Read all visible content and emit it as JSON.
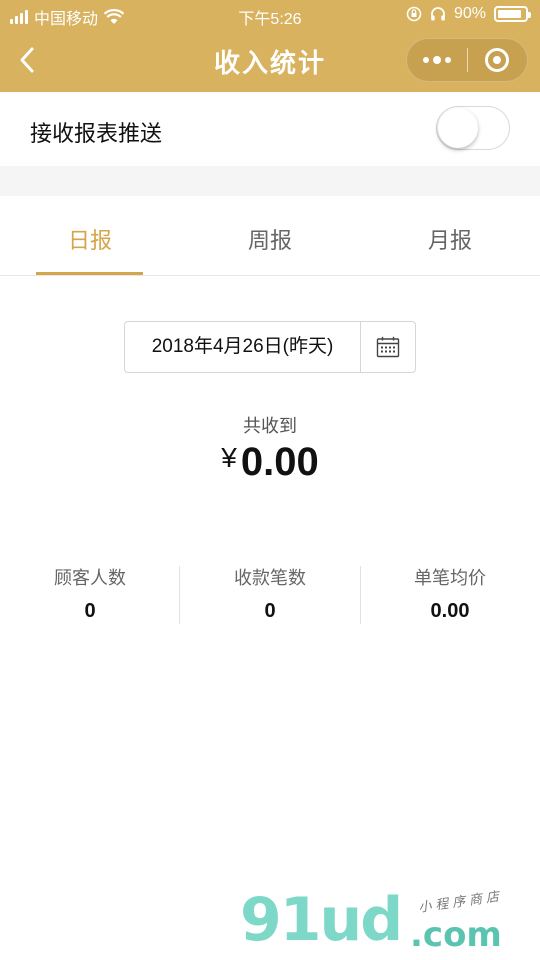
{
  "status_bar": {
    "carrier": "中国移动",
    "time": "下午5:26",
    "battery_text": "90%",
    "battery_level": 0.9
  },
  "nav": {
    "title": "收入统计",
    "back_icon": "chevron-left-icon",
    "more_icon": "more-dots-icon",
    "close_icon": "target-circle-icon"
  },
  "push": {
    "label": "接收报表推送",
    "enabled": false
  },
  "tabs": [
    {
      "label": "日报",
      "active": true
    },
    {
      "label": "周报",
      "active": false
    },
    {
      "label": "月报",
      "active": false
    }
  ],
  "date_picker": {
    "value": "2018年4月26日(昨天)",
    "icon": "calendar-icon"
  },
  "total": {
    "label": "共收到",
    "currency": "¥",
    "amount": "0.00"
  },
  "stats": [
    {
      "label": "顾客人数",
      "value": "0"
    },
    {
      "label": "收款笔数",
      "value": "0"
    },
    {
      "label": "单笔均价",
      "value": "0.00"
    }
  ],
  "watermark": {
    "brand": "91ud",
    "domain": ".com",
    "tagline": "小程序商店"
  },
  "colors": {
    "accent": "#d8b25f",
    "tab_active": "#d4a54a",
    "watermark": "#7ed8c7"
  }
}
